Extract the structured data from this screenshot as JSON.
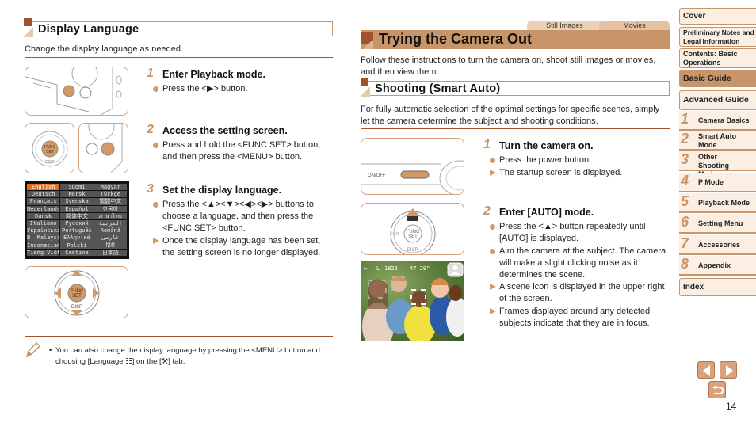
{
  "left": {
    "section_title": "Display Language",
    "intro": "Change the display language as needed.",
    "steps": [
      {
        "num": "1",
        "title": "Enter Playback mode.",
        "items": [
          {
            "type": "bullet",
            "text": "Press the <▶> button."
          }
        ]
      },
      {
        "num": "2",
        "title": "Access the setting screen.",
        "items": [
          {
            "type": "bullet",
            "text": "Press and hold the <FUNC SET> button, and then press the <MENU> button."
          }
        ]
      },
      {
        "num": "3",
        "title": "Set the display language.",
        "items": [
          {
            "type": "bullet",
            "text": "Press the <▲><▼><◀><▶> buttons to choose a language, and then press the <FUNC SET> button."
          },
          {
            "type": "result",
            "text": "Once the display language has been set, the setting screen is no longer displayed."
          }
        ]
      }
    ],
    "language_screen": {
      "selected": "English",
      "languages": [
        "English",
        "Suomi",
        "Magyar",
        "Deutsch",
        "Norsk",
        "Türkçe",
        "Français",
        "Svenska",
        "繁體中文",
        "Nederlands",
        "Español",
        "한국어",
        "Dansk",
        "简体中文",
        "ภาษาไทย",
        "Italiano",
        "Русский",
        "العربية",
        "Українська",
        "Português",
        "Română",
        "B. Malaysia",
        "Ελληνικά",
        "فارسی",
        "Indonesian",
        "Polski",
        "हिंदी",
        "Tiếng Việt",
        "Čeština",
        "日本語"
      ]
    },
    "note": "You can also change the display language by pressing the <MENU> button and choosing [Language ☷] on the [⚒] tab."
  },
  "middle": {
    "tabs": [
      "Still Images",
      "Movies"
    ],
    "title": "Trying the Camera Out",
    "intro": "Follow these instructions to turn the camera on, shoot still images or movies, and then view them.",
    "sub_title": "Shooting (Smart Auto)",
    "sub_intro": "For fully automatic selection of the optimal settings for specific scenes, simply let the camera determine the subject and shooting conditions.",
    "steps": [
      {
        "num": "1",
        "title": "Turn the camera on.",
        "items": [
          {
            "type": "bullet",
            "text": "Press the power button."
          },
          {
            "type": "result",
            "text": "The startup screen is displayed."
          }
        ]
      },
      {
        "num": "2",
        "title": "Enter [AUTO] mode.",
        "items": [
          {
            "type": "bullet",
            "text": "Press the <▲> button repeatedly until [AUTO] is displayed."
          },
          {
            "type": "bullet",
            "text": "Aim the camera at the subject. The camera will make a slight clicking noise as it determines the scene."
          },
          {
            "type": "result",
            "text": "A scene icon is displayed in the upper right of the screen."
          },
          {
            "type": "result",
            "text": "Frames displayed around any detected subjects indicate that they are in focus."
          }
        ]
      }
    ],
    "illus_labels": {
      "onoff": "ON/OFF",
      "func": "FUNC",
      "set": "SET",
      "disp": "DISP.",
      "eco": "ECO"
    },
    "photo_osd": {
      "battery": "▭",
      "size": "L",
      "shots": "1826",
      "time": "47'29\""
    }
  },
  "nav": {
    "items": [
      {
        "label": "Cover"
      },
      {
        "label": "Preliminary Notes and Legal Information"
      },
      {
        "label": "Contents: Basic Operations"
      },
      {
        "label": "Basic Guide",
        "active": true
      },
      {
        "label": "Advanced Guide"
      }
    ],
    "chapters": [
      {
        "num": "1",
        "label": "Camera Basics"
      },
      {
        "num": "2",
        "label": "Smart Auto Mode"
      },
      {
        "num": "3",
        "label": "Other Shooting Modes"
      },
      {
        "num": "4",
        "label": "P Mode"
      },
      {
        "num": "5",
        "label": "Playback Mode"
      },
      {
        "num": "6",
        "label": "Setting Menu"
      },
      {
        "num": "7",
        "label": "Accessories"
      },
      {
        "num": "8",
        "label": "Appendix"
      }
    ],
    "index": "Index",
    "page_number": "14"
  },
  "colors": {
    "accent": "#c8956a",
    "dark_accent": "#a0522d",
    "bullet": "#d49a66"
  }
}
